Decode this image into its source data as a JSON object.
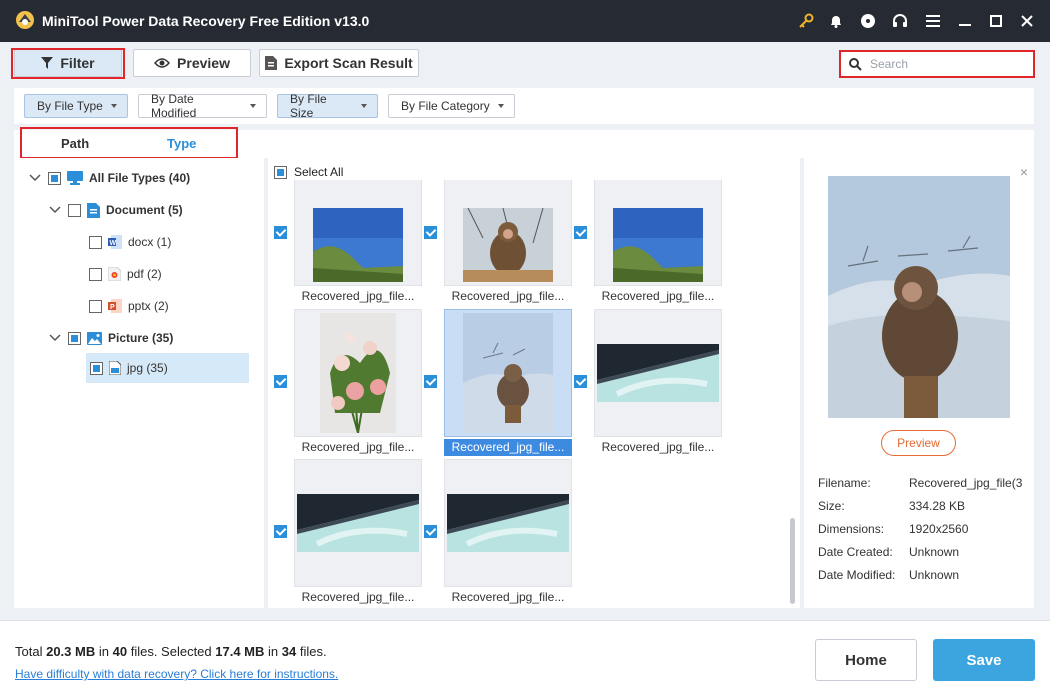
{
  "app": {
    "title": "MiniTool Power Data Recovery Free Edition v13.0"
  },
  "titlebar": {
    "icons": [
      "key-icon",
      "bell-icon",
      "disc-icon",
      "headset-icon",
      "menu-icon",
      "minimize-icon",
      "maximize-icon",
      "close-icon"
    ]
  },
  "toolbar": {
    "filter_label": "Filter",
    "preview_label": "Preview",
    "export_label": "Export Scan Result",
    "search_placeholder": "Search"
  },
  "filters": {
    "by_file_type": "By File Type",
    "by_date_modified": "By Date Modified",
    "by_file_size": "By File Size",
    "by_file_category": "By File Category"
  },
  "tabs": {
    "path": "Path",
    "type": "Type"
  },
  "tree": {
    "all": "All File Types (40)",
    "document": "Document (5)",
    "docx": "docx (1)",
    "pdf": "pdf (2)",
    "pptx": "pptx (2)",
    "picture": "Picture (35)",
    "jpg": "jpg (35)"
  },
  "grid": {
    "select_all": "Select All",
    "items": [
      {
        "name": "Recovered_jpg_file...",
        "warn": ""
      },
      {
        "name": "Recovered_jpg_file...",
        "warn": ""
      },
      {
        "name": "Recovered_jpg_file...",
        "warn": ""
      },
      {
        "name": "Recovered_jpg_file...",
        "warn": "!"
      },
      {
        "name": "Recovered_jpg_file...",
        "warn": "!"
      },
      {
        "name": "Recovered_jpg_file...",
        "warn": "!"
      },
      {
        "name": "Recovered_jpg_file...",
        "warn": "!"
      },
      {
        "name": "Recovered_jpg_file...",
        "warn": "!"
      }
    ]
  },
  "details": {
    "preview_button": "Preview",
    "filename_label": "Filename:",
    "filename_value": "Recovered_jpg_file(3",
    "size_label": "Size:",
    "size_value": "334.28 KB",
    "dimensions_label": "Dimensions:",
    "dimensions_value": "1920x2560",
    "created_label": "Date Created:",
    "created_value": "Unknown",
    "modified_label": "Date Modified:",
    "modified_value": "Unknown"
  },
  "footer": {
    "total_prefix": "Total",
    "total_size": "20.3 MB",
    "in_1": "in",
    "total_files": "40",
    "files_sel": "files.  Selected",
    "selected_size": "17.4 MB",
    "in_2": "in",
    "selected_files": "34",
    "files_end": "files.",
    "help_link": "Have difficulty with data recovery? Click here for instructions.",
    "home_button": "Home",
    "save_button": "Save"
  },
  "colors": {
    "accent": "#2a8fd8",
    "highlight": "#e0262b",
    "save": "#3ca5e0",
    "titlebar": "#262a33"
  }
}
